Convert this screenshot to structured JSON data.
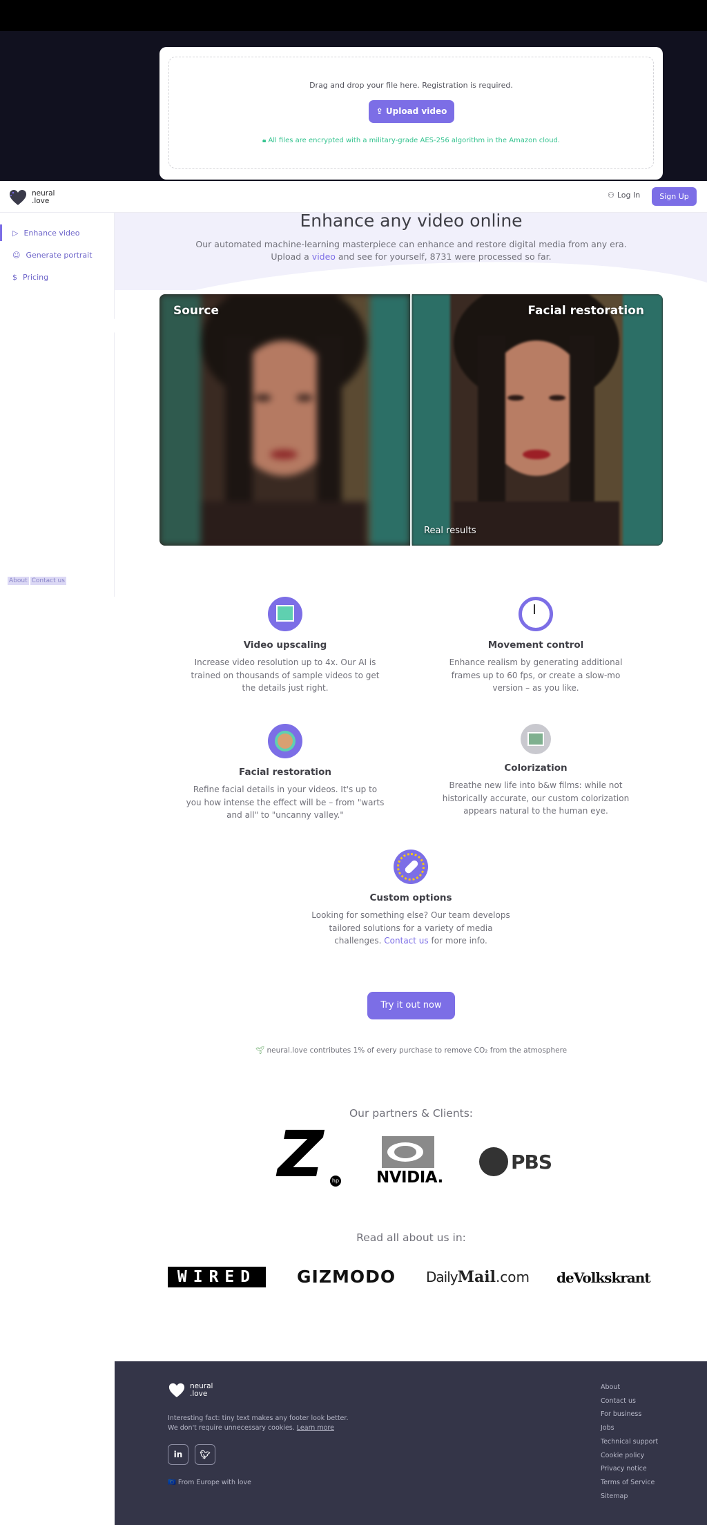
{
  "upload": {
    "instruction": "Drag and drop your file here. Registration is required.",
    "button": "Upload video",
    "encryption": "All files are encrypted with a military-grade AES-256 algorithm in the Amazon cloud."
  },
  "nav": {
    "logo_line1": "neural",
    "logo_line2": ".love",
    "login": "Log In",
    "signup": "Sign Up"
  },
  "sidebar": {
    "items": [
      {
        "label": "Enhance video",
        "icon": "play-icon"
      },
      {
        "label": "Generate portrait",
        "icon": "smile-icon"
      },
      {
        "label": "Pricing",
        "icon": "dollar-icon"
      }
    ],
    "footer_about": "About",
    "footer_contact": "Contact us"
  },
  "hero": {
    "title": "Enhance any video online",
    "sub_line1": "Our automated machine-learning masterpiece can enhance and restore digital media from any era.",
    "sub_pre": "Upload a ",
    "sub_link": "video",
    "sub_post": " and see for yourself, 8731 were processed so far."
  },
  "compare": {
    "source_label": "Source",
    "result_label": "Facial restoration",
    "real_results": "Real results"
  },
  "features": [
    {
      "title": "Video upscaling",
      "desc": "Increase video resolution up to 4x. Our AI is trained on thousands of sample videos to get the details just right.",
      "icon": "image-upscale-icon"
    },
    {
      "title": "Movement control",
      "desc": "Enhance realism by generating additional frames up to 60 fps, or create a slow-mo version – as you like.",
      "icon": "stopwatch-icon"
    },
    {
      "title": "Facial restoration",
      "desc": "Refine facial details in your videos. It's up to you how intense the effect will be – from \"warts and all\" to \"uncanny valley.\"",
      "icon": "face-icon"
    },
    {
      "title": "Colorization",
      "desc": "Breathe new life into b&w films: while not historically accurate, our custom colorization appears natural to the human eye.",
      "icon": "colorization-icon"
    },
    {
      "title": "Custom options",
      "desc_pre": "Looking for something else? Our team develops tailored solutions for a variety of media challenges. ",
      "desc_link": "Contact us",
      "desc_post": " for more info.",
      "icon": "rocket-icon"
    }
  ],
  "cta": {
    "try": "Try it out now"
  },
  "co2": "neural.love contributes 1% of every purchase to remove CO₂ from the atmosphere",
  "partners": {
    "heading": "Our partners & Clients:",
    "logos": [
      "Z",
      "NVIDIA.",
      "PBS"
    ]
  },
  "press": {
    "heading": "Read all about us in:",
    "logos": [
      "WIRED",
      "GIZMODO",
      "Daily",
      "Mail",
      ".com",
      "deVolkskrant"
    ]
  },
  "footer": {
    "logo_line1": "neural",
    "logo_line2": ".love",
    "fact_line1": "Interesting fact: tiny text makes any footer look better.",
    "fact_line2_pre": "We don't require unnecessary cookies. ",
    "fact_link": "Learn more",
    "linkedin": "in",
    "europe": "From Europe with love",
    "links": [
      "About",
      "Contact us",
      "For business",
      "Jobs",
      "Technical support",
      "Cookie policy",
      "Privacy notice",
      "Terms of Service",
      "Sitemap"
    ]
  },
  "colors": {
    "accent": "#7c6ee6",
    "footer_bg": "#343548",
    "encrypt_green": "#34c38f"
  }
}
